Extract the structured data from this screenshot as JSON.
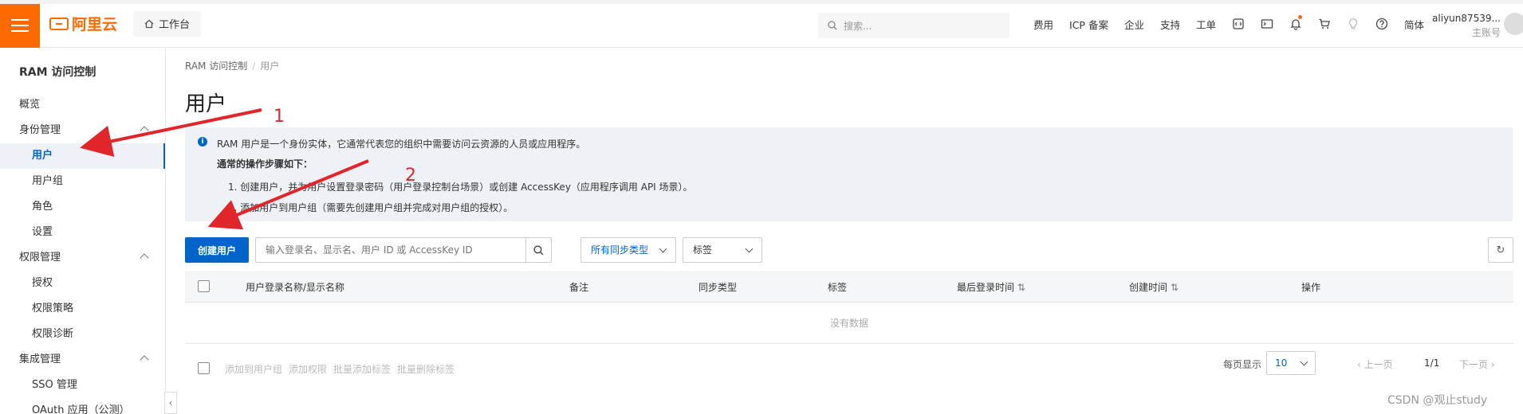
{
  "topbar": {
    "brand": "阿里云",
    "workbench": "工作台",
    "search_placeholder": "搜索...",
    "nav": [
      "费用",
      "ICP 备案",
      "企业",
      "支持",
      "工单"
    ],
    "lang": "简体",
    "account_name": "aliyun87539...",
    "account_type": "主账号",
    "accent_color": "#ff6a00"
  },
  "sidebar": {
    "title": "RAM 访问控制",
    "items": [
      {
        "label": "概览",
        "kind": "group"
      },
      {
        "label": "身份管理",
        "kind": "group"
      },
      {
        "label": "用户",
        "kind": "child",
        "active": true
      },
      {
        "label": "用户组",
        "kind": "child"
      },
      {
        "label": "角色",
        "kind": "child"
      },
      {
        "label": "设置",
        "kind": "child"
      },
      {
        "label": "权限管理",
        "kind": "group"
      },
      {
        "label": "授权",
        "kind": "child"
      },
      {
        "label": "权限策略",
        "kind": "child"
      },
      {
        "label": "权限诊断",
        "kind": "child"
      },
      {
        "label": "集成管理",
        "kind": "group"
      },
      {
        "label": "SSO 管理",
        "kind": "child"
      },
      {
        "label": "OAuth 应用（公测）",
        "kind": "child"
      }
    ]
  },
  "main": {
    "breadcrumb": [
      "RAM 访问控制",
      "用户"
    ],
    "title": "用户",
    "notice": {
      "line1": "RAM 用户是一个身份实体，它通常代表您的组织中需要访问云资源的人员或应用程序。",
      "line2": "通常的操作步骤如下：",
      "line3": "1. 创建用户，并为用户设置登录密码（用户登录控制台场景）或创建 AccessKey（应用程序调用 API 场景）。",
      "line4": "2. 添加用户到用户组（需要先创建用户组并完成对用户组的授权）。"
    },
    "create_user": "创建用户",
    "filter_placeholder": "输入登录名、显示名、用户 ID 或 AccessKey ID",
    "sync_type": "所有同步类型",
    "tag_select": "标签",
    "columns": [
      "用户登录名称/显示名称",
      "备注",
      "同步类型",
      "标签",
      "最后登录时间",
      "创建时间",
      "操作"
    ],
    "empty": "没有数据",
    "batch_actions": [
      "添加到用户组",
      "添加权限",
      "批量添加标签",
      "批量删除标签"
    ],
    "page_size_label": "每页显示",
    "page_size": "10",
    "prev": "上一页",
    "page": "1/1",
    "next": "下一页",
    "primary_color": "#0064c8"
  },
  "annotations": {
    "arrow1": "1",
    "arrow2": "2"
  },
  "watermark": "CSDN @观止study"
}
